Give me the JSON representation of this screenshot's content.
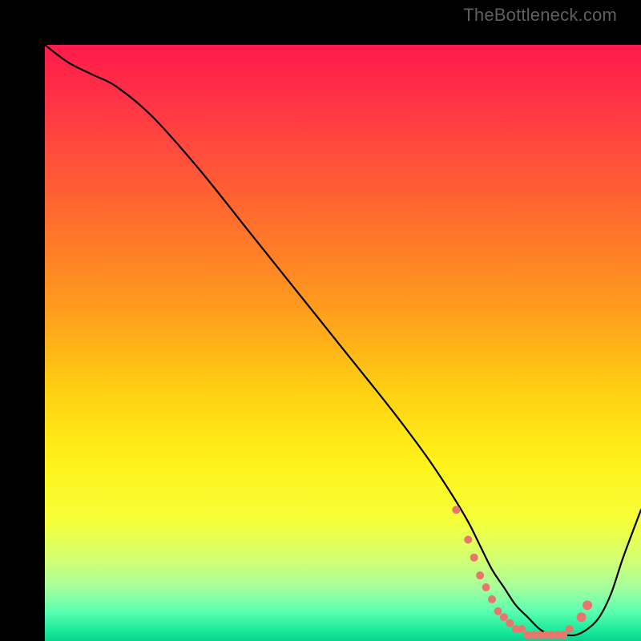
{
  "watermark": "TheBottleneck.com",
  "colors": {
    "gradient_stops": [
      {
        "offset": 0.0,
        "color": "#ff1a4b"
      },
      {
        "offset": 0.12,
        "color": "#ff3a44"
      },
      {
        "offset": 0.28,
        "color": "#ff6a2e"
      },
      {
        "offset": 0.44,
        "color": "#ff9b1e"
      },
      {
        "offset": 0.58,
        "color": "#ffd012"
      },
      {
        "offset": 0.7,
        "color": "#fff21a"
      },
      {
        "offset": 0.8,
        "color": "#f5ff3a"
      },
      {
        "offset": 0.86,
        "color": "#d4ff70"
      },
      {
        "offset": 0.91,
        "color": "#a6ff9c"
      },
      {
        "offset": 0.95,
        "color": "#5bffb0"
      },
      {
        "offset": 0.985,
        "color": "#17e89a"
      },
      {
        "offset": 1.0,
        "color": "#0ad18f"
      }
    ],
    "curve": "#000000",
    "marker": "#e9766e",
    "background": "#000000"
  },
  "chart_data": {
    "type": "line",
    "title": "",
    "xlabel": "",
    "ylabel": "",
    "xlim": [
      0,
      100
    ],
    "ylim": [
      0,
      100
    ],
    "series": [
      {
        "name": "bottleneck-curve",
        "x": [
          0,
          4,
          8,
          12,
          18,
          26,
          34,
          42,
          50,
          58,
          64,
          68,
          71,
          73,
          75,
          77,
          79,
          81,
          83,
          85,
          87,
          89,
          91,
          93,
          95,
          97,
          100
        ],
        "y": [
          100,
          97,
          95,
          93,
          88,
          79,
          69,
          59,
          49,
          39,
          31,
          25,
          20,
          16,
          12,
          9,
          6,
          4,
          2,
          1,
          1,
          1,
          2,
          4,
          8,
          14,
          22
        ]
      }
    ],
    "markers": {
      "name": "highlight-points",
      "x": [
        69,
        71,
        72,
        73,
        74,
        75,
        76,
        77,
        78,
        79,
        80,
        81,
        82,
        83,
        84,
        85,
        86,
        87,
        88,
        90,
        91
      ],
      "y": [
        22,
        17,
        14,
        11,
        9,
        7,
        5,
        4,
        3,
        2,
        2,
        1,
        1,
        1,
        1,
        1,
        1,
        1,
        2,
        4,
        6
      ],
      "r": [
        5,
        5,
        5,
        5,
        5,
        5,
        5,
        5,
        5,
        5,
        5,
        5,
        5,
        5,
        5,
        5,
        5,
        5,
        5,
        6,
        6
      ]
    }
  }
}
